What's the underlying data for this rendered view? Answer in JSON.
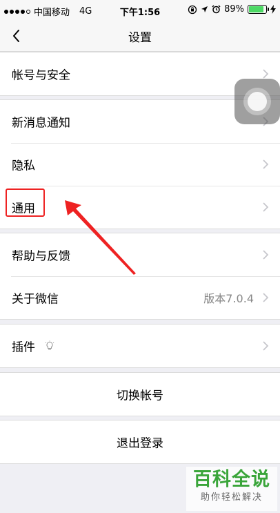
{
  "status_bar": {
    "carrier": "中国移动",
    "network": "4G",
    "time": "下午1:56",
    "battery": "89%",
    "battery_level": 0.89,
    "battery_color": "#4cd964",
    "signal_strength": 4,
    "icons": [
      "orientation-lock-icon",
      "location-icon",
      "alarm-icon",
      "charging-icon"
    ]
  },
  "nav": {
    "back_icon": "chevron-left-icon",
    "title": "设置"
  },
  "sections": {
    "account": {
      "label": "帐号与安全"
    },
    "notifications": {
      "label": "新消息通知"
    },
    "privacy": {
      "label": "隐私"
    },
    "general": {
      "label": "通用"
    },
    "help": {
      "label": "帮助与反馈"
    },
    "about": {
      "label": "关于微信",
      "value": "版本7.0.4"
    },
    "plugins": {
      "label": "插件",
      "icon": "lightbulb-icon"
    },
    "switch_account": {
      "label": "切换帐号"
    },
    "logout": {
      "label": "退出登录"
    }
  },
  "annotation": {
    "highlight_color": "#ee2222",
    "target": "通用"
  },
  "watermark": {
    "title": "百科全说",
    "subtitle": "助你轻松解决"
  }
}
